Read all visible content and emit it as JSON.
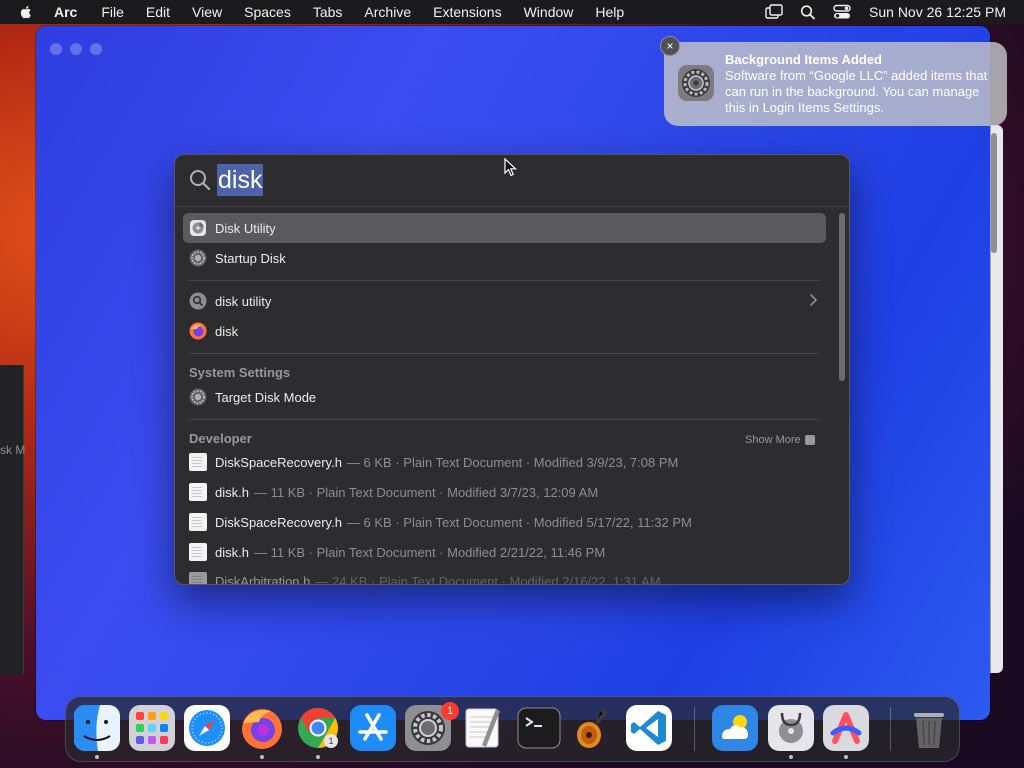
{
  "menubar": {
    "app_name": "Arc",
    "items": [
      "File",
      "Edit",
      "View",
      "Spaces",
      "Tabs",
      "Archive",
      "Extensions",
      "Window",
      "Help"
    ],
    "clock": "Sun Nov 26  12:25 PM",
    "status_icons": [
      "window-icon",
      "search-icon",
      "control-center-icon"
    ]
  },
  "background": {
    "left_window_cutoff_text": "sk M"
  },
  "notification": {
    "title": "Background Items Added",
    "body": "Software from “Google LLC” added items that can run in the background. You can manage this in Login Items Settings.",
    "close_label": "×",
    "icon": "system-settings-icon"
  },
  "spotlight": {
    "query": "disk",
    "top_hits": [
      {
        "label": "Disk Utility",
        "icon": "disk-utility-icon",
        "selected": true
      },
      {
        "label": "Startup Disk",
        "icon": "system-settings-icon",
        "selected": false
      }
    ],
    "suggestions": [
      {
        "label": "disk utility",
        "icon": "search-icon",
        "has_chevron": true
      },
      {
        "label": "disk",
        "icon": "firefox-icon",
        "has_chevron": false
      }
    ],
    "system_settings": {
      "heading": "System Settings",
      "items": [
        {
          "label": "Target Disk Mode",
          "icon": "system-settings-icon"
        }
      ]
    },
    "developer": {
      "heading": "Developer",
      "show_more": "Show More",
      "items": [
        {
          "name": "DiskSpaceRecovery.h",
          "meta": "— 6 KB · Plain Text Document · Modified 3/9/23, 7:08 PM"
        },
        {
          "name": "disk.h",
          "meta": "— 11 KB · Plain Text Document · Modified 3/7/23, 12:09 AM"
        },
        {
          "name": "DiskSpaceRecovery.h",
          "meta": "— 6 KB · Plain Text Document · Modified 5/17/22, 11:32 PM"
        },
        {
          "name": "disk.h",
          "meta": "— 11 KB · Plain Text Document · Modified 2/21/22, 11:46 PM"
        },
        {
          "name": "DiskArbitration.h",
          "meta": "— 24 KB · Plain Text Document · Modified 2/16/22, 1:31 AM"
        }
      ]
    }
  },
  "dock": {
    "apps": [
      {
        "name": "Finder",
        "icon": "finder-icon",
        "running": true
      },
      {
        "name": "Launchpad",
        "icon": "launchpad-icon",
        "running": false
      },
      {
        "name": "Safari",
        "icon": "safari-icon",
        "running": false
      },
      {
        "name": "Firefox",
        "icon": "firefox-icon",
        "running": true
      },
      {
        "name": "Chrome",
        "icon": "chrome-icon",
        "running": true
      },
      {
        "name": "App Store",
        "icon": "app-store-icon",
        "running": false
      },
      {
        "name": "System Settings",
        "icon": "system-settings-icon",
        "running": false,
        "badge": "1"
      },
      {
        "name": "TextEdit",
        "icon": "textedit-icon",
        "running": false
      },
      {
        "name": "Terminal",
        "icon": "terminal-icon",
        "running": false
      },
      {
        "name": "GarageBand",
        "icon": "garageband-icon",
        "running": false
      },
      {
        "name": "Visual Studio Code",
        "icon": "vscode-icon",
        "running": false
      },
      {
        "name": "Weather",
        "icon": "weather-icon",
        "running": false
      },
      {
        "name": "Disk Utility",
        "icon": "disk-utility-icon",
        "running": true
      },
      {
        "name": "Arc",
        "icon": "arc-icon",
        "running": true
      },
      {
        "name": "Trash",
        "icon": "trash-icon",
        "running": false
      }
    ]
  },
  "colors": {
    "desktop_accent": "#e4541b",
    "arc_window_blue": "#2e3ee0",
    "spotlight_bg": "#2d2d2f",
    "selection": "#5a5a5e",
    "query_highlight": "#4d63a8",
    "badge_red": "#ff3b30"
  }
}
